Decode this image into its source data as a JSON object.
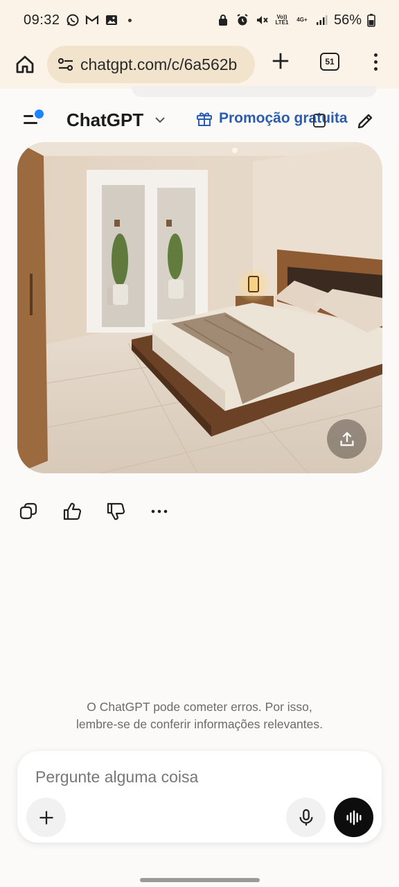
{
  "status_bar": {
    "time": "09:32",
    "battery_percent": "56%",
    "network_volte": "Vo)) LTE1",
    "network_4g": "4G+",
    "left_icons": [
      "whatsapp-icon",
      "gmail-icon",
      "gallery-icon",
      "notification-dot"
    ],
    "right_icons": [
      "lock-icon",
      "alarm-icon",
      "mute-icon",
      "signal-icon",
      "battery-icon"
    ]
  },
  "browser": {
    "url": "chatgpt.com/c/6a562b",
    "tab_count": "51",
    "icons": [
      "home-icon",
      "site-settings-icon",
      "new-tab-icon",
      "tabs-icon",
      "more-icon"
    ]
  },
  "chat_header": {
    "title": "ChatGPT",
    "promo_label": "Promoção gratuita",
    "icons": [
      "sidebar-menu-icon",
      "chevron-down-icon",
      "gift-icon",
      "temporary-chat-icon",
      "edit-icon"
    ]
  },
  "generated_image": {
    "description_alt": "",
    "share_icon": "share-icon"
  },
  "message_actions": {
    "icons": [
      "copy-icon",
      "thumbs-up-icon",
      "thumbs-down-icon",
      "more-horizontal-icon"
    ]
  },
  "disclaimer": {
    "line1": "O ChatGPT pode cometer erros. Por isso,",
    "line2": "lembre-se de conferir informações relevantes."
  },
  "composer": {
    "placeholder": "Pergunte alguma coisa",
    "value": "",
    "icons": [
      "plus-icon",
      "microphone-icon",
      "voice-mode-icon"
    ]
  },
  "colors": {
    "browser_bg": "#fbf3e8",
    "url_bg": "#f2e3cc",
    "promo_blue": "#2a5db0",
    "accent_dot": "#1b84ff",
    "voice_button": "#0d0d0d"
  }
}
